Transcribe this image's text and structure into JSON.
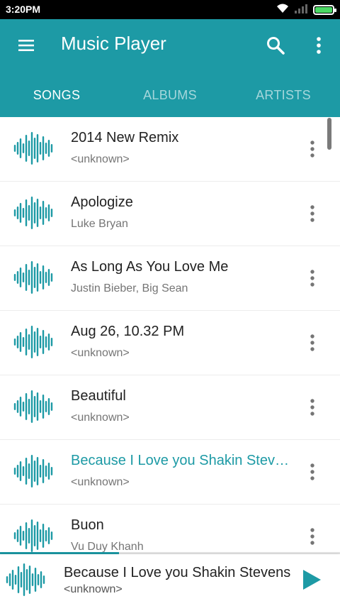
{
  "status_bar": {
    "time": "3:20PM",
    "icons": [
      "wifi-icon",
      "signal-icon",
      "battery-icon"
    ],
    "battery_level": 1.0
  },
  "app_bar": {
    "title": "Music Player",
    "icons": [
      "menu-icon",
      "search-icon",
      "more-vertical-icon"
    ]
  },
  "tabs": [
    {
      "label": "SONGS",
      "active": true
    },
    {
      "label": "ALBUMS",
      "active": false
    },
    {
      "label": "ARTISTS",
      "active": false
    }
  ],
  "songs": [
    {
      "title": "2014 New Remix",
      "artist": "<unknown>",
      "playing": false
    },
    {
      "title": "Apologize",
      "artist": "Luke Bryan",
      "playing": false
    },
    {
      "title": "As Long As You Love Me",
      "artist": "Justin Bieber, Big Sean",
      "playing": false
    },
    {
      "title": "Aug 26, 10.32 PM",
      "artist": "<unknown>",
      "playing": false
    },
    {
      "title": "Beautiful",
      "artist": "<unknown>",
      "playing": false
    },
    {
      "title": "Because I Love you Shakin Stevens",
      "artist": "<unknown>",
      "playing": true
    },
    {
      "title": "Buon",
      "artist": "Vu Duy Khanh",
      "playing": false
    }
  ],
  "now_playing": {
    "title": "Because I Love you Shakin Stevens",
    "artist": "<unknown>",
    "progress": 0.35
  },
  "colors": {
    "accent": "#1d9aa5",
    "text_primary": "#222222",
    "text_secondary": "#757575"
  }
}
